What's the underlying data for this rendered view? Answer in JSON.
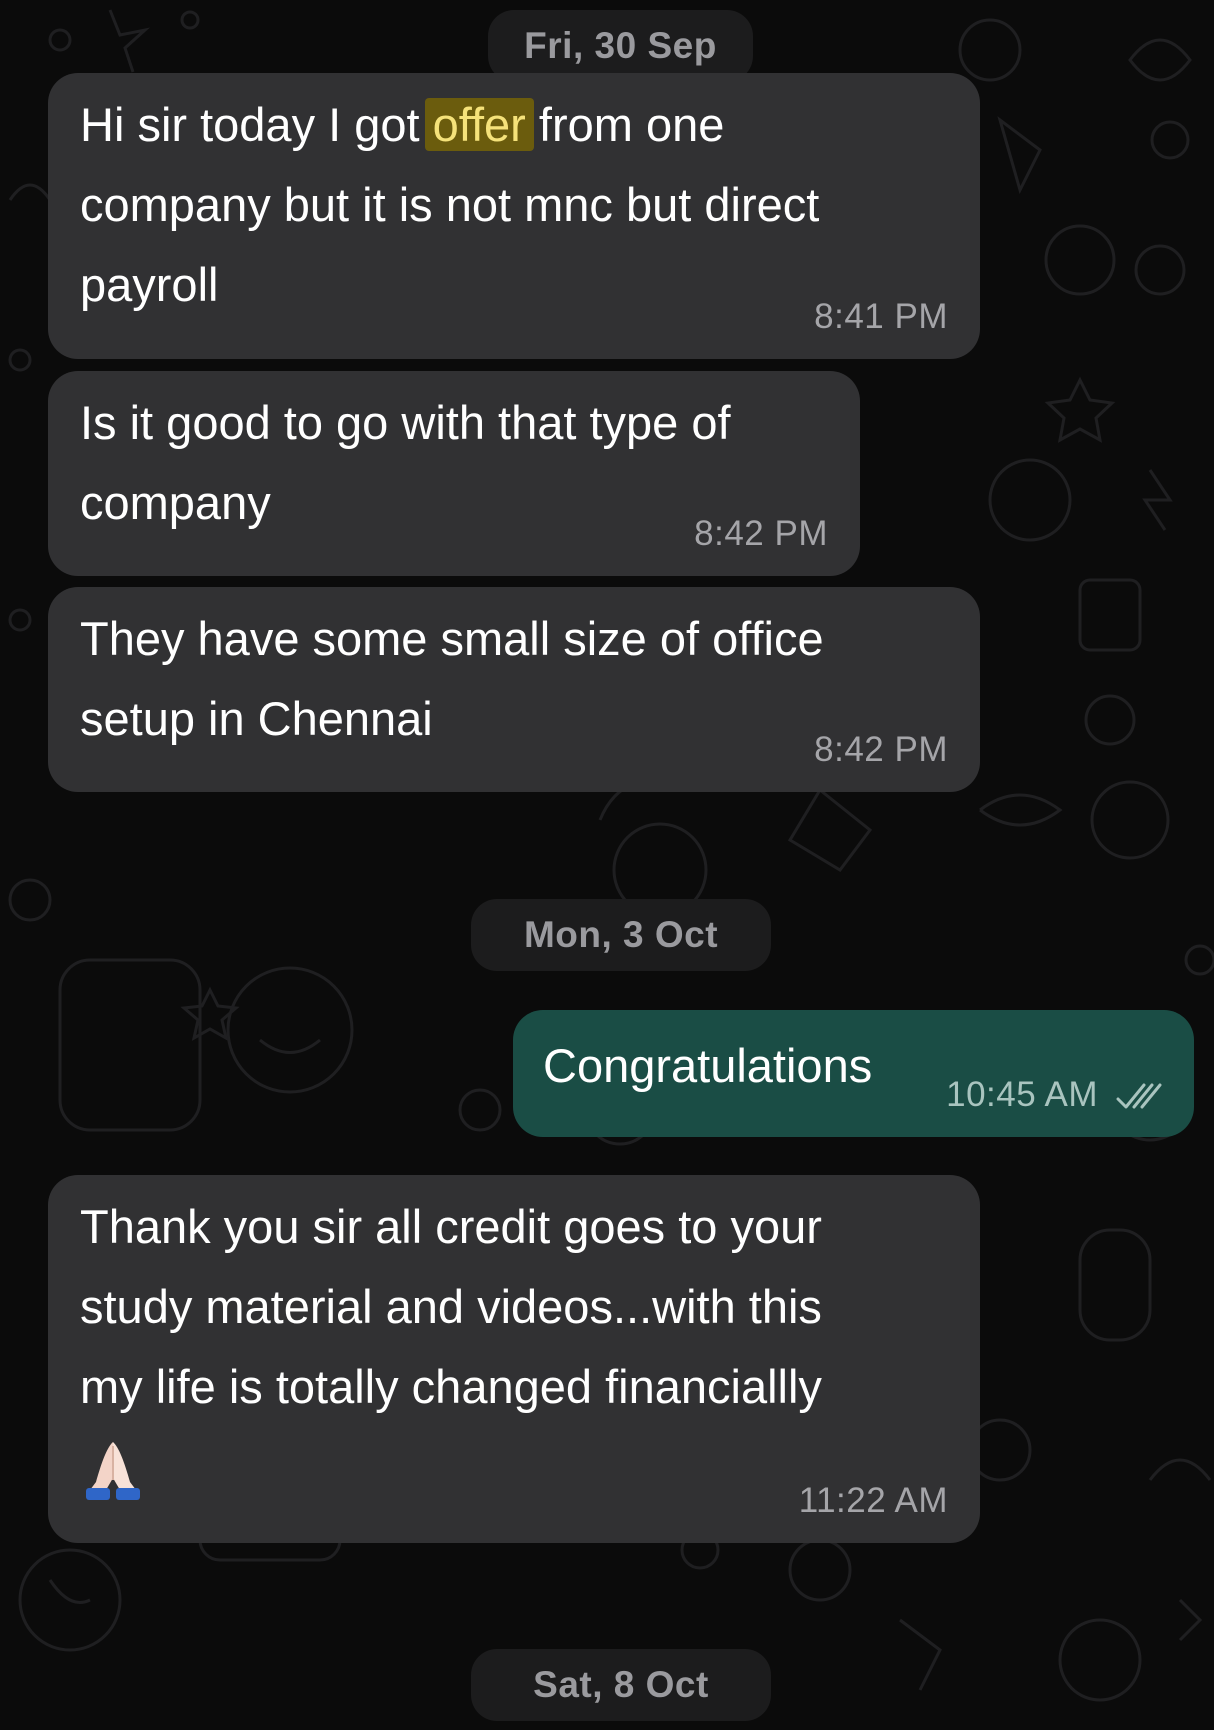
{
  "dates": {
    "d1": "Fri, 30 Sep",
    "d2": "Mon, 3 Oct",
    "d3": "Sat, 8 Oct"
  },
  "messages": [
    {
      "direction": "incoming",
      "lines": {
        "l1_a": "Hi sir today I got ",
        "l1_hl": "offer",
        "l1_b": " from one",
        "l2": "company but it is not mnc but direct",
        "l3": "payroll"
      },
      "time": "8:41 PM",
      "search_highlight": "offer"
    },
    {
      "direction": "incoming",
      "lines": {
        "l1": "Is it good to go with that type of",
        "l2": "company"
      },
      "time": "8:42 PM"
    },
    {
      "direction": "incoming",
      "lines": {
        "l1": "They have some small size of office",
        "l2": "setup in Chennai"
      },
      "time": "8:42 PM"
    },
    {
      "direction": "outgoing",
      "lines": {
        "l1": "Congratulations"
      },
      "time": "10:45 AM",
      "status_icon": "double-check-icon"
    },
    {
      "direction": "incoming",
      "lines": {
        "l1": "Thank you sir all credit goes to your",
        "l2": "study material and videos...with this",
        "l3": "my life is totally changed financiallly"
      },
      "emoji": "folded-hands-icon",
      "time": "11:22 AM"
    }
  ],
  "colors": {
    "background": "#0b0b0b",
    "incoming_bubble": "#313133",
    "outgoing_bubble": "#1a4d45",
    "highlight": "#6b5c0d",
    "date_chip": "#1c1c1d"
  }
}
